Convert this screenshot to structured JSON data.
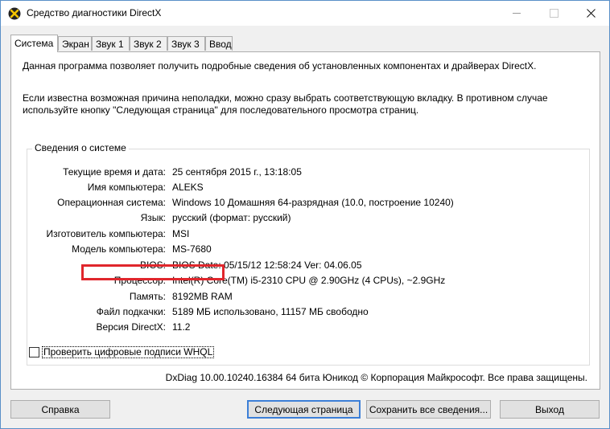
{
  "window": {
    "title": "Средство диагностики DirectX",
    "app_icon": "directx-x-icon"
  },
  "tabs": [
    {
      "label": "Система",
      "active": true
    },
    {
      "label": "Экран"
    },
    {
      "label": "Звук 1"
    },
    {
      "label": "Звук 2"
    },
    {
      "label": "Звук 3"
    },
    {
      "label": "Ввод"
    }
  ],
  "intro": {
    "line1": "Данная программа позволяет получить подробные сведения об установленных компонентах и драйверах DirectX.",
    "line2": "Если известна возможная причина неполадки, можно сразу выбрать соответствующую вкладку. В противном случае используйте кнопку \"Следующая страница\" для последовательного просмотра страниц."
  },
  "system_info": {
    "group_label": "Сведения о системе",
    "rows": [
      {
        "label": "Текущие время и дата:",
        "value": "25 сентября 2015 г., 13:18:05"
      },
      {
        "label": "Имя компьютера:",
        "value": "ALEKS"
      },
      {
        "label": "Операционная система:",
        "value": "Windows 10 Домашняя 64-разрядная (10.0, построение 10240)"
      },
      {
        "label": "Язык:",
        "value": "русский (формат: русский)"
      },
      {
        "label": "Изготовитель компьютера:",
        "value": "MSI"
      },
      {
        "label": "Модель компьютера:",
        "value": "MS-7680"
      },
      {
        "label": "BIOS:",
        "value": "BIOS Date: 05/15/12 12:58:24 Ver: 04.06.05"
      },
      {
        "label": "Процессор:",
        "value": "Intel(R) Core(TM) i5-2310 CPU @ 2.90GHz (4 CPUs), ~2.9GHz"
      },
      {
        "label": "Память:",
        "value": "8192MB RAM"
      },
      {
        "label": "Файл подкачки:",
        "value": "5189 МБ использовано, 11157 МБ свободно"
      },
      {
        "label": "Версия DirectX:",
        "value": "11.2"
      }
    ],
    "highlight_color": "#e0262c"
  },
  "whql_checkbox": {
    "label": "Проверить цифровые подписи WHQL",
    "checked": false
  },
  "copyright": "DxDiag 10.00.10240.16384 64 бита Юникод  © Корпорация Майкрософт. Все права защищены.",
  "buttons": {
    "help": "Справка",
    "next_page": "Следующая страница",
    "save_all": "Сохранить все сведения...",
    "exit": "Выход"
  }
}
